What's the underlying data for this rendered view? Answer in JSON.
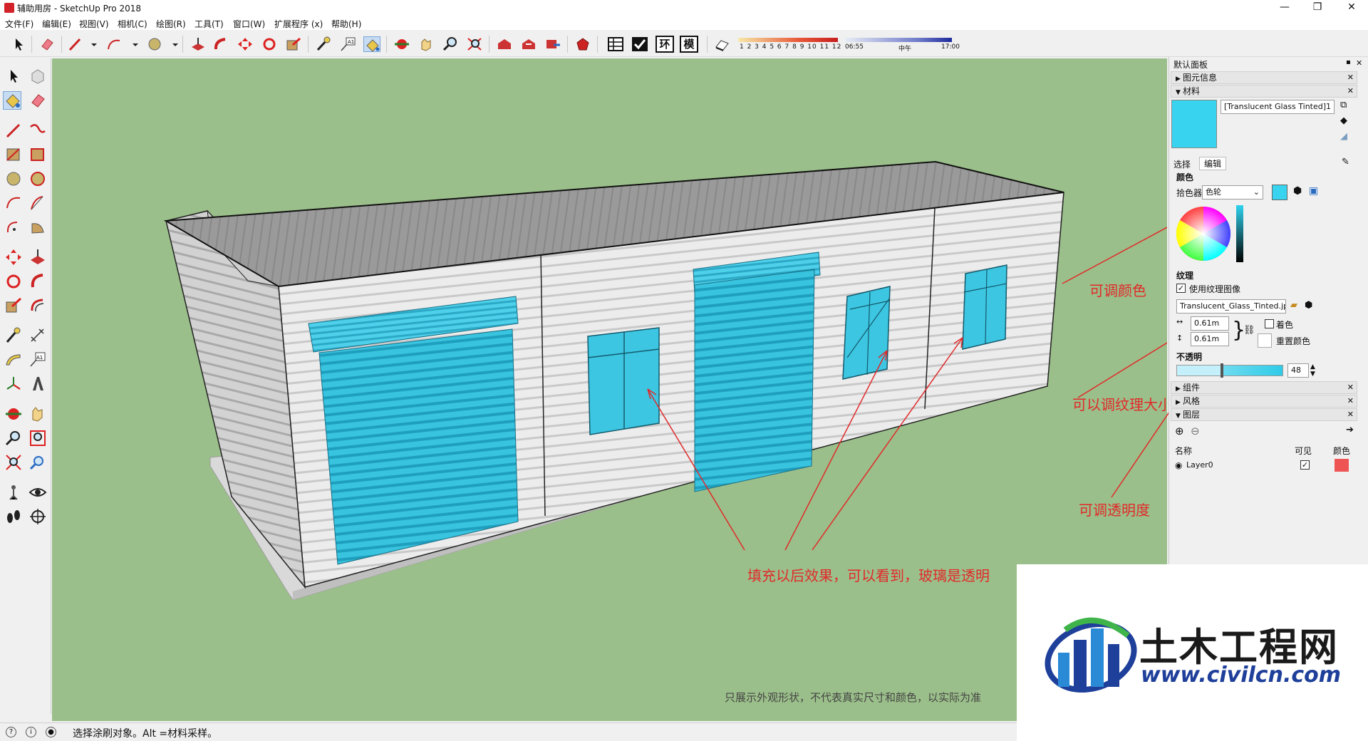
{
  "window": {
    "title": "辅助用房 - SketchUp Pro 2018",
    "minimize": "—",
    "maximize": "❐",
    "close": "✕"
  },
  "menu": [
    "文件(F)",
    "编辑(E)",
    "视图(V)",
    "相机(C)",
    "绘图(R)",
    "工具(T)",
    "窗口(W)",
    "扩展程序 (x)",
    "帮助(H)"
  ],
  "toolbar": {
    "boxes": [
      "环",
      "模"
    ],
    "months": "1 2 3 4 5 6 7 8 9 10 11 12",
    "time_start": "06:55",
    "time_mid": "中午",
    "time_end": "17:00"
  },
  "panel": {
    "title": "默认面板",
    "entity_info": "图元信息",
    "materials": "材料",
    "material_name": "[Translucent Glass Tinted]1",
    "tab_select": "选择",
    "tab_edit": "编辑",
    "color_heading": "颜色",
    "picker_label": "拾色器:",
    "picker_value": "色轮",
    "texture_heading": "纹理",
    "use_texture": "使用纹理图像",
    "texture_file": "Translucent_Glass_Tinted.jpg",
    "tex_width": "0.61m",
    "tex_height": "0.61m",
    "colorize": "着色",
    "reset_color": "重置颜色",
    "opacity_heading": "不透明",
    "opacity_value": "48",
    "components": "组件",
    "styles": "风格",
    "layers": "图层",
    "layers_col_name": "名称",
    "layers_col_visible": "可见",
    "layers_col_color": "颜色",
    "layer0": "Layer0",
    "swatch_color": "#37d3ef",
    "layer_color": "#ef5454"
  },
  "annotations": {
    "color": "可调颜色",
    "texture": "可以调纹理大小",
    "opacity": "可调透明度",
    "result": "填充以后效果，可以看到，玻璃是透明"
  },
  "disclaimer": "只展示外观形状，不代表真实尺寸和颜色，以实际为准",
  "status": "选择涂刷对象。Alt =材料采样。",
  "logo": {
    "cn": "土木工程网",
    "url": "www.civilcn.com"
  }
}
